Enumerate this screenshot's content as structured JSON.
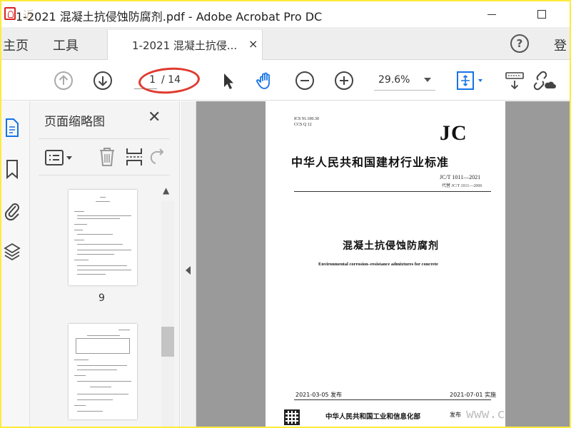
{
  "window": {
    "title": "1-2021 混凝土抗侵蚀防腐剂.pdf - Adobe Acrobat Pro DC",
    "watermark": "近"
  },
  "tabbar": {
    "home_label": "主页",
    "tools_label": "工具",
    "document_tab_label": "1-2021 混凝土抗侵...",
    "close_symbol": "×",
    "help_symbol": "?",
    "signin_label": "登"
  },
  "toolbar": {
    "current_page": "1",
    "page_total": "/ 14",
    "zoom_value": "29.6%"
  },
  "thumbnail_panel": {
    "title": "页面缩略图",
    "close_symbol": "✕",
    "thumbnails": [
      {
        "page_label": "9"
      }
    ]
  },
  "document": {
    "ics": "ICS 91.100.30",
    "ccs": "CCS Q 12",
    "publisher_mark": "JC",
    "standard_title": "中华人民共和国建材行业标准",
    "standard_code": "JC/T 1011—2021",
    "replaces": "代替 JC/T 1011—2006",
    "title_cn": "混凝土抗侵蚀防腐剂",
    "title_en": "Environmental corrosion–resistance admixtures for concrete",
    "release_date": "2021-03-05 发布",
    "implement_date": "2021-07-01 实施",
    "issuer": "中华人民共和国工业和信息化部",
    "issue_word": "发布",
    "watermark_url": "www.c"
  },
  "colors": {
    "highlight_oval": "#e03a2e",
    "accent_blue": "#1473e6",
    "frame_border": "#ffeb3b"
  }
}
